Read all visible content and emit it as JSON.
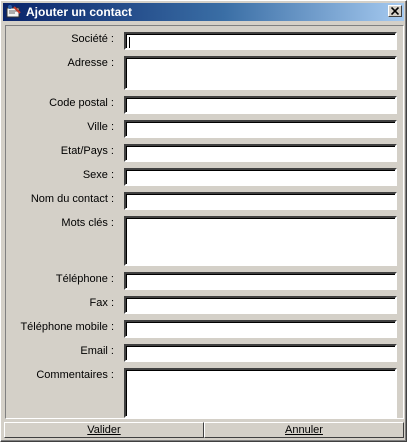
{
  "window": {
    "title": "Ajouter un contact"
  },
  "fields": [
    {
      "label": "Société :",
      "value": ""
    },
    {
      "label": "Adresse :",
      "value": ""
    },
    {
      "label": "Code postal :",
      "value": ""
    },
    {
      "label": "Ville :",
      "value": ""
    },
    {
      "label": "Etat/Pays :",
      "value": ""
    },
    {
      "label": "Sexe :",
      "value": ""
    },
    {
      "label": "Nom du contact :",
      "value": ""
    },
    {
      "label": "Mots clés :",
      "value": ""
    },
    {
      "label": "Téléphone :",
      "value": ""
    },
    {
      "label": "Fax :",
      "value": ""
    },
    {
      "label": "Téléphone mobile :",
      "value": ""
    },
    {
      "label": "Email :",
      "value": ""
    },
    {
      "label": "Commentaires :",
      "value": ""
    }
  ],
  "buttons": {
    "validate": "Valider",
    "cancel": "Annuler"
  }
}
